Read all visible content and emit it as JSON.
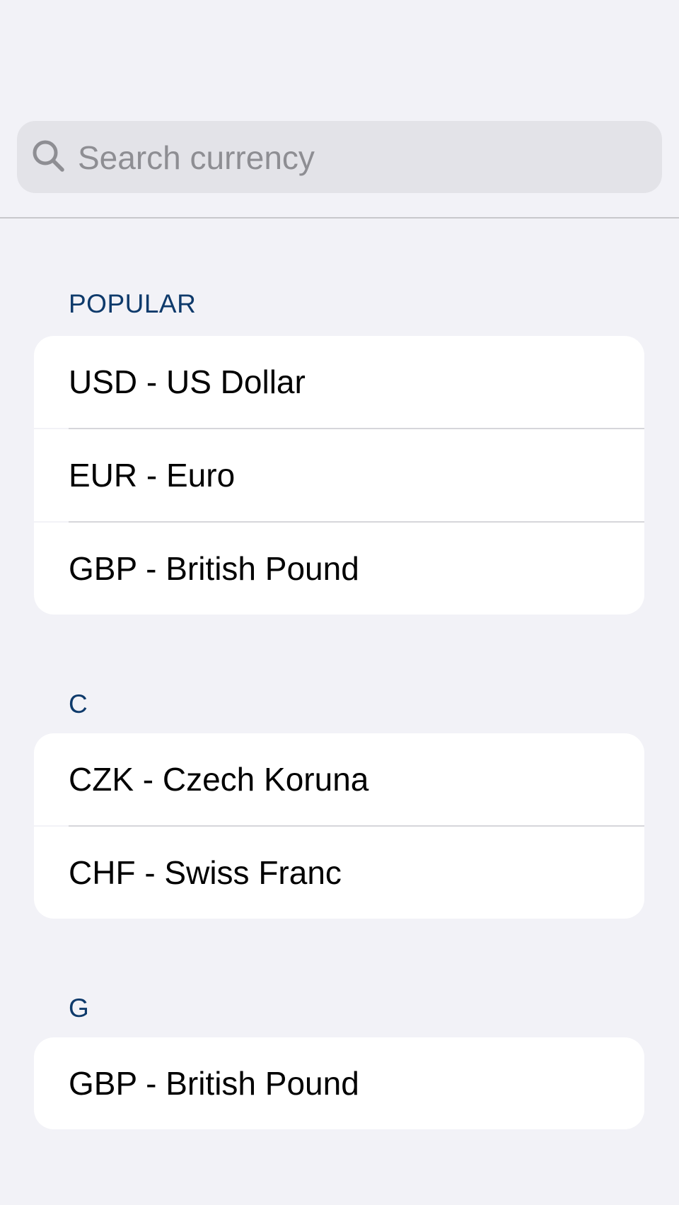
{
  "search": {
    "placeholder": "Search currency",
    "icon": "search-icon"
  },
  "sections": [
    {
      "header": "POPULAR",
      "items": [
        {
          "label": "USD - US Dollar"
        },
        {
          "label": "EUR - Euro"
        },
        {
          "label": "GBP - British Pound"
        }
      ]
    },
    {
      "header": "C",
      "items": [
        {
          "label": "CZK - Czech Koruna"
        },
        {
          "label": "CHF - Swiss Franc"
        }
      ]
    },
    {
      "header": "G",
      "items": [
        {
          "label": "GBP - British Pound"
        }
      ]
    }
  ],
  "colors": {
    "background": "#F2F2F7",
    "section_header": "#0E3A6B",
    "search_field": "#E3E3E8",
    "placeholder": "#8E8E93"
  }
}
